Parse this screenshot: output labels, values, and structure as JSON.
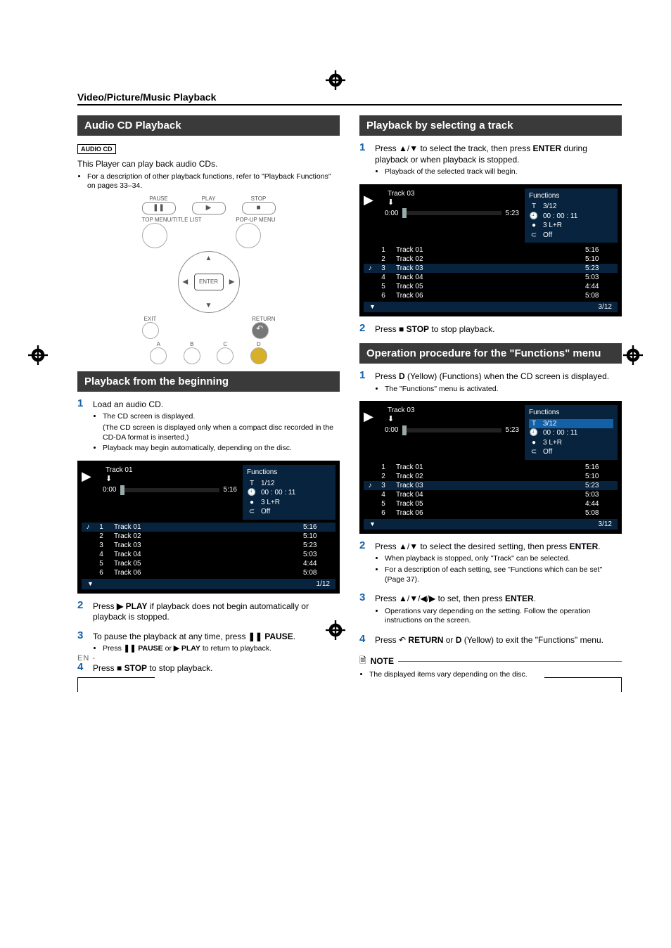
{
  "section_title": "Video/Picture/Music Playback",
  "en_mark": "EN -",
  "left": {
    "banner1": "Audio CD Playback",
    "badge": "AUDIO CD",
    "intro": "This Player can play back audio CDs.",
    "intro_bullet": "For a description of other playback functions, refer to \"Playback Functions\" on pages 33–34.",
    "remote": {
      "labels": {
        "pause": "PAUSE",
        "play": "PLAY",
        "stop": "STOP",
        "topmenu": "TOP MENU/TITLE LIST",
        "popup": "POP-UP MENU",
        "enter": "ENTER",
        "exit": "EXIT",
        "return": "RETURN",
        "a": "A",
        "b": "B",
        "c": "C",
        "d": "D"
      }
    },
    "banner2": "Playback from the beginning",
    "steps": {
      "1": {
        "text": "Load an audio CD.",
        "bullets": [
          "The CD screen is displayed.",
          "(The CD screen is displayed only when a compact disc recorded in the CD-DA format is inserted.)",
          "Playback may begin automatically, depending on the disc."
        ]
      },
      "2": {
        "text_pre": "Press ",
        "btn": "▶ PLAY",
        "text_post": " if playback does not begin automatically or playback is stopped."
      },
      "3": {
        "text_pre": "To pause the playback at any time, press ",
        "btn": "❚❚ PAUSE",
        "text_post": ".",
        "sub_pre": "Press ",
        "sub_btn1": "❚❚ PAUSE",
        "sub_mid": " or ",
        "sub_btn2": "▶ PLAY",
        "sub_post": " to return to playback."
      },
      "4": {
        "text_pre": "Press ",
        "btn": "■ STOP",
        "text_post": " to stop playback."
      }
    },
    "screen1": {
      "title": "Track 01",
      "elapsed": "0:00",
      "total": "5:16",
      "page": "1/12",
      "functions_hdr": "Functions",
      "f_track": "1/12",
      "f_time": "00 : 00 : 11",
      "f_ch": "3    L+R",
      "f_rep": "Off",
      "selected_idx": 1,
      "highlight_idx": 1,
      "tracks": [
        {
          "n": "1",
          "name": "Track 01",
          "time": "5:16"
        },
        {
          "n": "2",
          "name": "Track 02",
          "time": "5:10"
        },
        {
          "n": "3",
          "name": "Track 03",
          "time": "5:23"
        },
        {
          "n": "4",
          "name": "Track 04",
          "time": "5:03"
        },
        {
          "n": "5",
          "name": "Track 05",
          "time": "4:44"
        },
        {
          "n": "6",
          "name": "Track 06",
          "time": "5:08"
        }
      ]
    }
  },
  "right": {
    "banner1": "Playback by selecting a track",
    "step1": {
      "text_pre": "Press ",
      "keys": "▲/▼",
      "text_mid": " to select the track, then press ",
      "enter": "ENTER",
      "text_post": " during playback or when playback is stopped.",
      "bullet": "Playback of the selected track will begin."
    },
    "screenA": {
      "title": "Track 03",
      "elapsed": "0:00",
      "total": "5:23",
      "page": "3/12",
      "functions_hdr": "Functions",
      "f_track": "3/12",
      "f_time": "00 : 00 : 11",
      "f_ch": "3    L+R",
      "f_rep": "Off",
      "selected_idx": 3,
      "highlight_idx": 3,
      "tracks": [
        {
          "n": "1",
          "name": "Track 01",
          "time": "5:16"
        },
        {
          "n": "2",
          "name": "Track 02",
          "time": "5:10"
        },
        {
          "n": "3",
          "name": "Track 03",
          "time": "5:23"
        },
        {
          "n": "4",
          "name": "Track 04",
          "time": "5:03"
        },
        {
          "n": "5",
          "name": "Track 05",
          "time": "4:44"
        },
        {
          "n": "6",
          "name": "Track 06",
          "time": "5:08"
        }
      ]
    },
    "step2": {
      "text_pre": "Press ",
      "btn": "■ STOP",
      "text_post": " to stop playback."
    },
    "banner2": "Operation procedure for the \"Functions\" menu",
    "op1": {
      "text_pre": "Press ",
      "key": "D",
      "color": "(Yellow)",
      "fn": "(Functions)",
      "text_post": " when the CD screen is displayed.",
      "bullet": "The \"Functions\" menu is activated."
    },
    "screenB": {
      "title": "Track 03",
      "elapsed": "0:00",
      "total": "5:23",
      "page": "3/12",
      "functions_hdr": "Functions",
      "f_track": "3/12",
      "f_time": "00 : 00 : 11",
      "f_ch": "3    L+R",
      "f_rep": "Off",
      "selected_idx": 3,
      "highlight_idx": 3,
      "func_highlight": true,
      "tracks": [
        {
          "n": "1",
          "name": "Track 01",
          "time": "5:16"
        },
        {
          "n": "2",
          "name": "Track 02",
          "time": "5:10"
        },
        {
          "n": "3",
          "name": "Track 03",
          "time": "5:23"
        },
        {
          "n": "4",
          "name": "Track 04",
          "time": "5:03"
        },
        {
          "n": "5",
          "name": "Track 05",
          "time": "4:44"
        },
        {
          "n": "6",
          "name": "Track 06",
          "time": "5:08"
        }
      ]
    },
    "op2": {
      "text_pre": "Press ",
      "keys": "▲/▼",
      "text_mid": " to select the desired setting, then press ",
      "enter": "ENTER",
      "text_post": ".",
      "bullets": [
        "When playback is stopped, only \"Track\" can be selected.",
        "For a description of each setting, see \"Functions which can be set\" (Page 37)."
      ]
    },
    "op3": {
      "text_pre": "Press ",
      "keys": "▲/▼/◀/▶",
      "text_mid": " to set, then press ",
      "enter": "ENTER",
      "text_post": ".",
      "bullet": "Operations vary depending on the setting. Follow the operation instructions on the screen."
    },
    "op4": {
      "text_pre": "Press ",
      "ret_icon": "↶",
      "ret": " RETURN",
      "text_mid": " or ",
      "key": "D",
      "color": "(Yellow)",
      "text_post": " to exit the \"Functions\" menu."
    },
    "note_hdr": "NOTE",
    "note_bullet": "The displayed items vary depending on the disc."
  }
}
